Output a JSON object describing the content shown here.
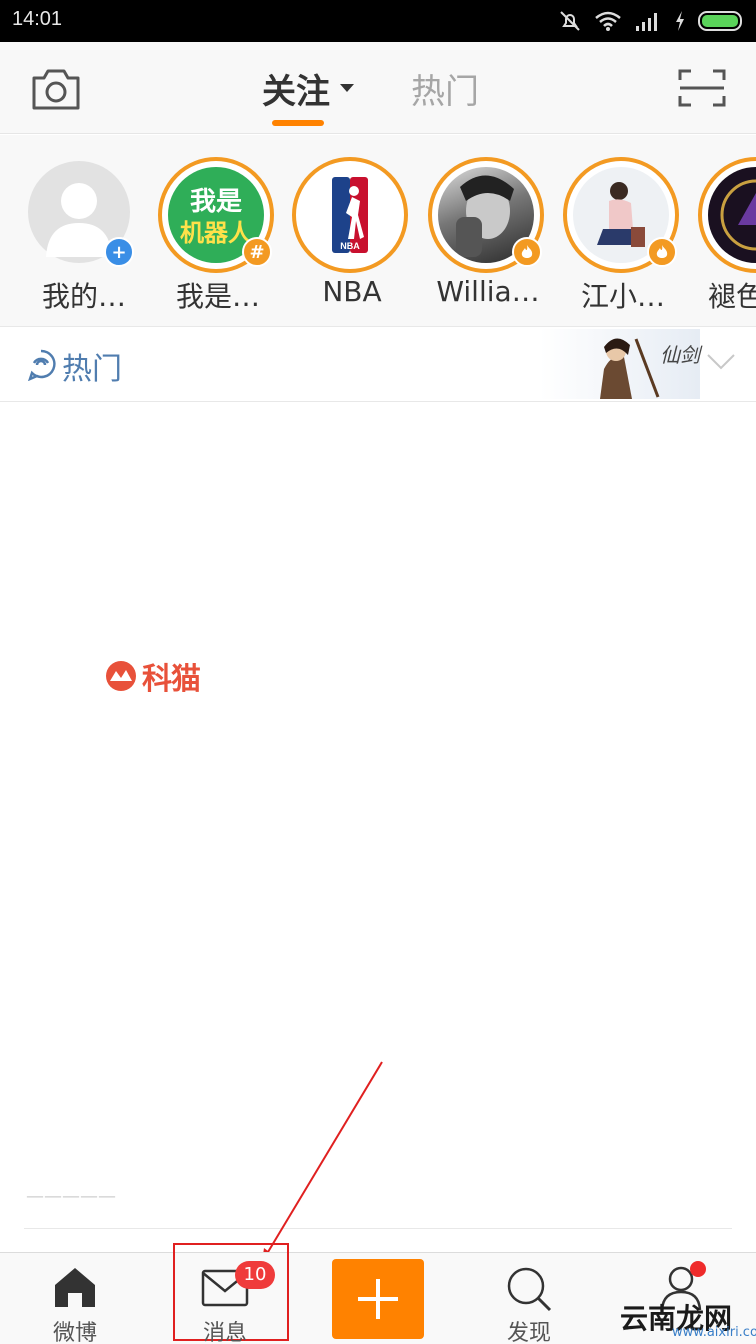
{
  "status_bar": {
    "time": "14:01"
  },
  "header": {
    "tabs": [
      {
        "label": "关注",
        "active": true
      },
      {
        "label": "热门",
        "active": false
      }
    ],
    "accent_color": "#ff8200"
  },
  "stories": [
    {
      "name": "我的…",
      "badge": "+",
      "badge_color": "#3a8ee6",
      "avatar": "default-avatar"
    },
    {
      "name": "我是…",
      "badge": "#",
      "badge_color": "#f39a22",
      "avatar_text_top": "我是",
      "avatar_text_bottom": "机器人"
    },
    {
      "name": "NBA",
      "avatar": "nba-logo"
    },
    {
      "name": "Willia…",
      "badge": "fire",
      "badge_color": "#f39a22",
      "avatar": "person-photo"
    },
    {
      "name": "江小…",
      "badge": "fire",
      "badge_color": "#f39a22",
      "avatar": "person-photo"
    },
    {
      "name": "褪色…",
      "avatar": "game-logo"
    }
  ],
  "hot_section": {
    "label": "热门",
    "banner_text": "仙剑"
  },
  "feed": {
    "logo_text": "科猫",
    "faint_text": "—————"
  },
  "bottom_nav": {
    "items": [
      {
        "label": "微博",
        "icon": "home-icon"
      },
      {
        "label": "消息",
        "icon": "mail-icon",
        "badge": "10"
      },
      {
        "label": "",
        "icon": "plus-icon"
      },
      {
        "label": "发现",
        "icon": "search-icon"
      },
      {
        "label": "我",
        "icon": "profile-icon"
      }
    ],
    "watermark": "云南龙网",
    "watermark_url": "www.aixiri.com"
  }
}
